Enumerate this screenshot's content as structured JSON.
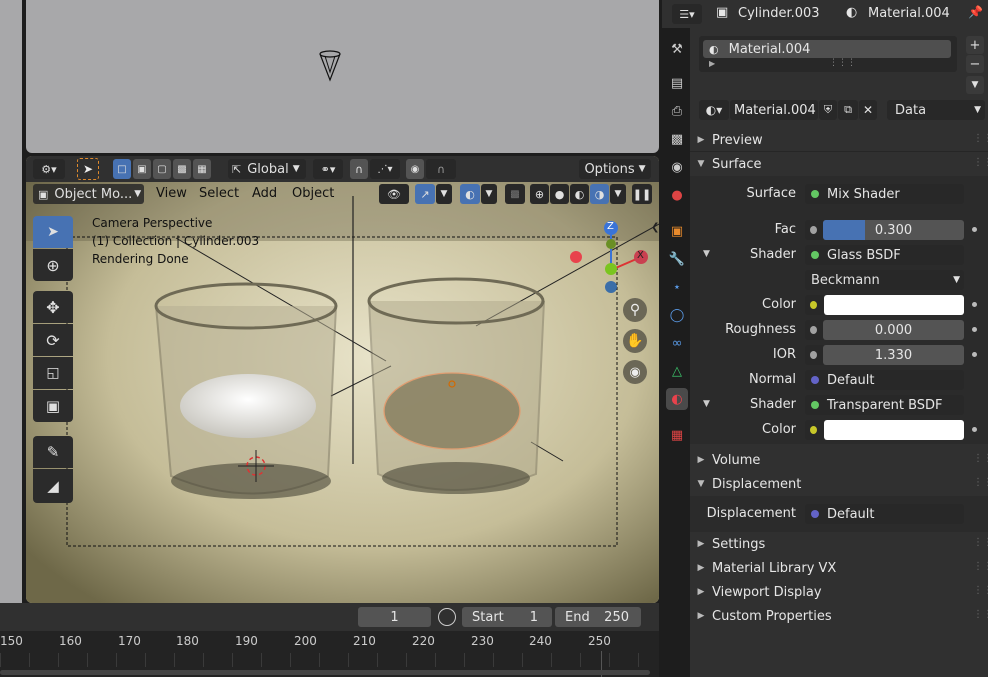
{
  "properties_header": {
    "object": "Cylinder.003",
    "material": "Material.004"
  },
  "material_slots": {
    "selected": "Material.004"
  },
  "material_selector": {
    "name": "Material.004",
    "link": "Data"
  },
  "panels": {
    "preview": "Preview",
    "surface": "Surface",
    "volume": "Volume",
    "displacement": "Displacement",
    "settings": "Settings",
    "material_library": "Material Library VX",
    "viewport_display": "Viewport Display",
    "custom_properties": "Custom Properties"
  },
  "surface_props": {
    "surface_label": "Surface",
    "surface_value": "Mix Shader",
    "fac_label": "Fac",
    "fac_value": "0.300",
    "fac_fraction": 0.3,
    "shader1_label": "Shader",
    "shader1_value": "Glass BSDF",
    "distribution": "Beckmann",
    "color_label": "Color",
    "color1": "#ffffff",
    "roughness_label": "Roughness",
    "roughness_value": "0.000",
    "ior_label": "IOR",
    "ior_value": "1.330",
    "normal_label": "Normal",
    "normal_value": "Default",
    "shader2_label": "Shader",
    "shader2_value": "Transparent BSDF",
    "color2_label": "Color",
    "color2": "#ffffff"
  },
  "displacement_props": {
    "label": "Displacement",
    "value": "Default"
  },
  "viewport_header": {
    "transform_orientation": "Global",
    "options": "Options",
    "mode": "Object Mo...",
    "menus": [
      "View",
      "Select",
      "Add",
      "Object"
    ]
  },
  "viewport_overlay": {
    "line1": "Camera Perspective",
    "line2": "(1) Collection | Cylinder.003",
    "line3": "Rendering Done"
  },
  "gizmo": {
    "z": "Z",
    "x": "X"
  },
  "timeline": {
    "current_frame": "1",
    "start_label": "Start",
    "start_value": "1",
    "end_label": "End",
    "end_value": "250",
    "ticks": [
      "150",
      "160",
      "170",
      "180",
      "190",
      "200",
      "210",
      "220",
      "230",
      "240",
      "250"
    ]
  },
  "colors": {
    "accent": "#4772b3",
    "shader_socket": "#63c763",
    "vector_socket": "#6363c7",
    "color_socket": "#c7c729"
  }
}
